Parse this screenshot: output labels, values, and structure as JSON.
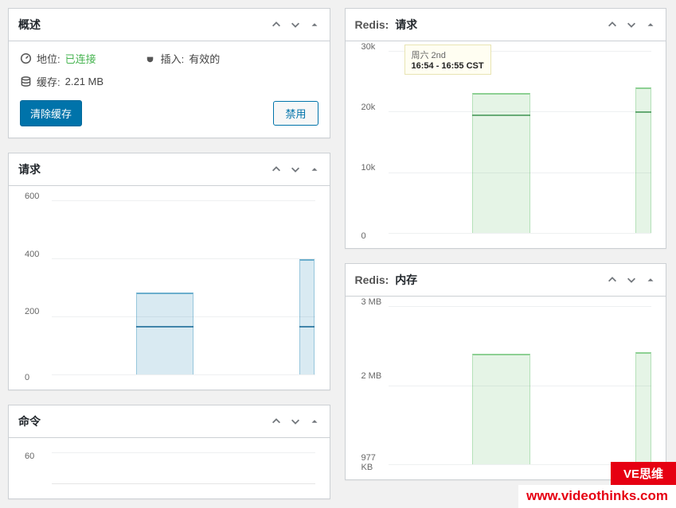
{
  "panels": {
    "overview": {
      "title": "概述",
      "location_label": "地位:",
      "location_value": "已连接",
      "plugin_label": "插入:",
      "plugin_value": "有效的",
      "cache_label": "缓存:",
      "cache_value": "2.21 MB",
      "flush_btn": "清除缓存",
      "disable_btn": "禁用"
    },
    "requests": {
      "title": "请求"
    },
    "commands": {
      "title": "命令"
    },
    "redis_requests": {
      "prefix": "Redis:",
      "title": "请求"
    },
    "redis_memory": {
      "prefix": "Redis:",
      "title": "内存"
    }
  },
  "tooltip": {
    "title": "周六 2nd",
    "body": "16:54 - 16:55 CST"
  },
  "watermark": {
    "tag": "VE思维",
    "url": "www.videothinks.com"
  },
  "chart_data": [
    {
      "id": "requests",
      "type": "area",
      "ylim": [
        0,
        600
      ],
      "yticks": [
        "600",
        "400",
        "200",
        "0"
      ],
      "series": [
        {
          "name": "series-a",
          "color": "blue",
          "segments": [
            {
              "x0": 0.32,
              "x1": 0.54,
              "y_top_pct": 53,
              "line_y_pct": 72
            },
            {
              "x0": 0.94,
              "x1": 1.0,
              "y_top_pct": 34,
              "line_y_pct": 72
            }
          ]
        }
      ]
    },
    {
      "id": "commands",
      "type": "area",
      "ylim": [
        0,
        60
      ],
      "yticks": [
        "60"
      ],
      "series": []
    },
    {
      "id": "redis_requests",
      "type": "area",
      "ylim": [
        0,
        30000
      ],
      "yticks": [
        "30k",
        "20k",
        "10k",
        "0"
      ],
      "series": [
        {
          "name": "series-a",
          "color": "green",
          "segments": [
            {
              "x0": 0.32,
              "x1": 0.54,
              "y_top_pct": 23,
              "line_y_pct": 35
            },
            {
              "x0": 0.94,
              "x1": 1.0,
              "y_top_pct": 20,
              "line_y_pct": 33
            }
          ]
        }
      ]
    },
    {
      "id": "redis_memory",
      "type": "area",
      "ylim": [
        0,
        3145728
      ],
      "yticks": [
        "3 MB",
        "2 MB",
        "977 KB"
      ],
      "series": [
        {
          "name": "series-a",
          "color": "green",
          "segments": [
            {
              "x0": 0.32,
              "x1": 0.54,
              "y_top_pct": 30,
              "line_y_pct": 30
            },
            {
              "x0": 0.94,
              "x1": 1.0,
              "y_top_pct": 29,
              "line_y_pct": 29
            }
          ]
        }
      ]
    }
  ]
}
